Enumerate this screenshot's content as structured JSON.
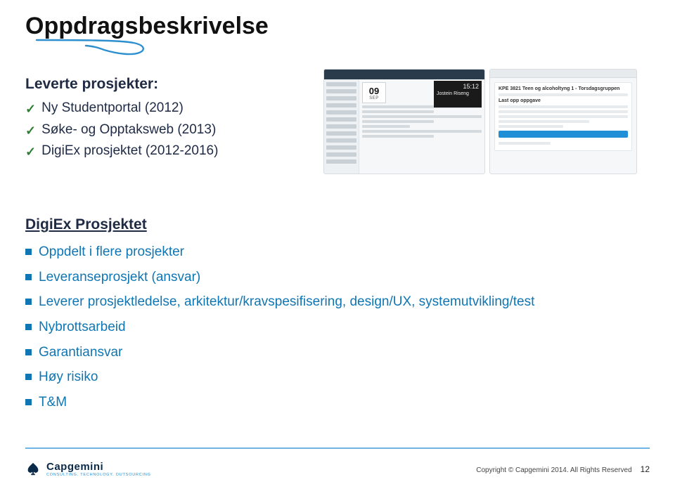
{
  "title": "Oppdragsbeskrivelse",
  "leverte_head": "Leverte prosjekter:",
  "leverte": [
    "Ny Studentportal (2012)",
    "Søke- og Opptaksweb (2013)",
    "DigiEx prosjektet (2012-2016)"
  ],
  "digix_head": "DigiEx Prosjektet",
  "digix_items": [
    "Oppdelt i flere prosjekter",
    "Leveranseprosjekt (ansvar)",
    "Leverer prosjektledelse, arkitektur/kravspesifisering, design/UX, systemutvikling/test",
    "Nybrottsarbeid",
    "Garantiansvar",
    "Høy risiko",
    "T&M"
  ],
  "screenshot_a": {
    "day": "09",
    "mon": "SEP",
    "time": "15:12",
    "name": "Jostein Riseng"
  },
  "screenshot_b": {
    "heading1": "KPE 3821 Teen og alcoholtyng 1 - Torsdagsgruppen",
    "heading2": "Last opp oppgave"
  },
  "logo": {
    "name": "Capgemini",
    "tagline": "CONSULTING. TECHNOLOGY. OUTSOURCING"
  },
  "copyright": "Copyright © Capgemini 2014. All Rights Reserved",
  "page_number": "12"
}
